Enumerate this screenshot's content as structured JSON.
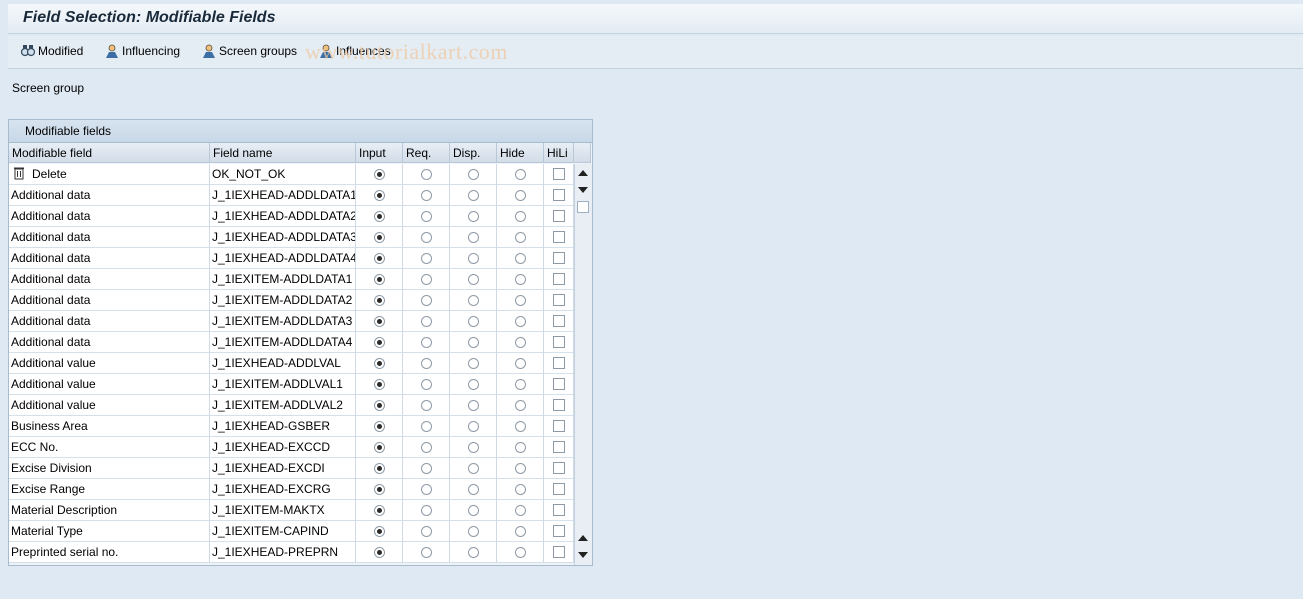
{
  "window": {
    "title": "Field Selection: Modifiable Fields"
  },
  "toolbar": {
    "items": [
      {
        "label": "Modified",
        "icon": "binoculars-icon"
      },
      {
        "label": "Influencing",
        "icon": "person-icon"
      },
      {
        "label": "Screen groups",
        "icon": "person-icon"
      },
      {
        "label": "Influences",
        "icon": "person-icon"
      }
    ]
  },
  "watermark": "www.tutorialkart.com",
  "screen_group_label": "Screen group",
  "table": {
    "title": "Modifiable fields",
    "columns": [
      "Modifiable field",
      "Field name",
      "Input",
      "Req.",
      "Disp.",
      "Hide",
      "HiLi"
    ],
    "selected_option": "Input",
    "rows": [
      {
        "field": "Delete",
        "name": "OK_NOT_OK",
        "icon": "trash-icon"
      },
      {
        "field": "Additional data",
        "name": "J_1IEXHEAD-ADDLDATA1"
      },
      {
        "field": "Additional data",
        "name": "J_1IEXHEAD-ADDLDATA2"
      },
      {
        "field": "Additional data",
        "name": "J_1IEXHEAD-ADDLDATA3"
      },
      {
        "field": "Additional data",
        "name": "J_1IEXHEAD-ADDLDATA4"
      },
      {
        "field": "Additional data",
        "name": "J_1IEXITEM-ADDLDATA1"
      },
      {
        "field": "Additional data",
        "name": "J_1IEXITEM-ADDLDATA2"
      },
      {
        "field": "Additional data",
        "name": "J_1IEXITEM-ADDLDATA3"
      },
      {
        "field": "Additional data",
        "name": "J_1IEXITEM-ADDLDATA4"
      },
      {
        "field": "Additional value",
        "name": "J_1IEXHEAD-ADDLVAL"
      },
      {
        "field": "Additional value",
        "name": "J_1IEXITEM-ADDLVAL1"
      },
      {
        "field": "Additional value",
        "name": "J_1IEXITEM-ADDLVAL2"
      },
      {
        "field": "Business Area",
        "name": "J_1IEXHEAD-GSBER"
      },
      {
        "field": "ECC No.",
        "name": "J_1IEXHEAD-EXCCD"
      },
      {
        "field": "Excise Division",
        "name": "J_1IEXHEAD-EXCDI"
      },
      {
        "field": "Excise Range",
        "name": "J_1IEXHEAD-EXCRG"
      },
      {
        "field": "Material Description",
        "name": "J_1IEXITEM-MAKTX"
      },
      {
        "field": "Material Type",
        "name": "J_1IEXITEM-CAPIND"
      },
      {
        "field": "Preprinted serial no.",
        "name": "J_1IEXHEAD-PREPRN"
      }
    ]
  }
}
